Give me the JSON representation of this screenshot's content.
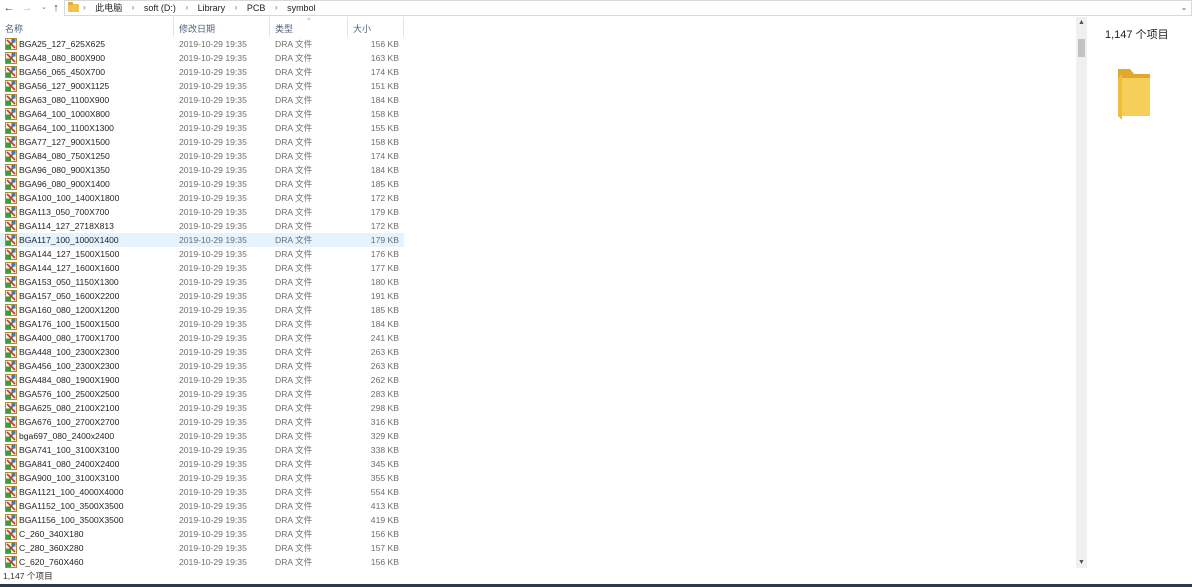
{
  "address": {
    "crumbs": [
      "此电脑",
      "soft (D:)",
      "Library",
      "PCB",
      "symbol"
    ]
  },
  "columns": {
    "name": "名称",
    "date": "修改日期",
    "type": "类型",
    "size": "大小"
  },
  "files": [
    {
      "name": "BGA25_127_625X625",
      "date": "2019-10-29 19:35",
      "type": "DRA 文件",
      "size": "156 KB"
    },
    {
      "name": "BGA48_080_800X900",
      "date": "2019-10-29 19:35",
      "type": "DRA 文件",
      "size": "163 KB"
    },
    {
      "name": "BGA56_065_450X700",
      "date": "2019-10-29 19:35",
      "type": "DRA 文件",
      "size": "174 KB"
    },
    {
      "name": "BGA56_127_900X1125",
      "date": "2019-10-29 19:35",
      "type": "DRA 文件",
      "size": "151 KB"
    },
    {
      "name": "BGA63_080_1100X900",
      "date": "2019-10-29 19:35",
      "type": "DRA 文件",
      "size": "184 KB"
    },
    {
      "name": "BGA64_100_1000X800",
      "date": "2019-10-29 19:35",
      "type": "DRA 文件",
      "size": "158 KB"
    },
    {
      "name": "BGA64_100_1100X1300",
      "date": "2019-10-29 19:35",
      "type": "DRA 文件",
      "size": "155 KB"
    },
    {
      "name": "BGA77_127_900X1500",
      "date": "2019-10-29 19:35",
      "type": "DRA 文件",
      "size": "158 KB"
    },
    {
      "name": "BGA84_080_750X1250",
      "date": "2019-10-29 19:35",
      "type": "DRA 文件",
      "size": "174 KB"
    },
    {
      "name": "BGA96_080_900X1350",
      "date": "2019-10-29 19:35",
      "type": "DRA 文件",
      "size": "184 KB"
    },
    {
      "name": "BGA96_080_900X1400",
      "date": "2019-10-29 19:35",
      "type": "DRA 文件",
      "size": "185 KB"
    },
    {
      "name": "BGA100_100_1400X1800",
      "date": "2019-10-29 19:35",
      "type": "DRA 文件",
      "size": "172 KB"
    },
    {
      "name": "BGA113_050_700X700",
      "date": "2019-10-29 19:35",
      "type": "DRA 文件",
      "size": "179 KB"
    },
    {
      "name": "BGA114_127_2718X813",
      "date": "2019-10-29 19:35",
      "type": "DRA 文件",
      "size": "172 KB"
    },
    {
      "name": "BGA117_100_1000X1400",
      "date": "2019-10-29 19:35",
      "type": "DRA 文件",
      "size": "179 KB",
      "selected": true
    },
    {
      "name": "BGA144_127_1500X1500",
      "date": "2019-10-29 19:35",
      "type": "DRA 文件",
      "size": "176 KB"
    },
    {
      "name": "BGA144_127_1600X1600",
      "date": "2019-10-29 19:35",
      "type": "DRA 文件",
      "size": "177 KB"
    },
    {
      "name": "BGA153_050_1150X1300",
      "date": "2019-10-29 19:35",
      "type": "DRA 文件",
      "size": "180 KB"
    },
    {
      "name": "BGA157_050_1600X2200",
      "date": "2019-10-29 19:35",
      "type": "DRA 文件",
      "size": "191 KB"
    },
    {
      "name": "BGA160_080_1200X1200",
      "date": "2019-10-29 19:35",
      "type": "DRA 文件",
      "size": "185 KB"
    },
    {
      "name": "BGA176_100_1500X1500",
      "date": "2019-10-29 19:35",
      "type": "DRA 文件",
      "size": "184 KB"
    },
    {
      "name": "BGA400_080_1700X1700",
      "date": "2019-10-29 19:35",
      "type": "DRA 文件",
      "size": "241 KB"
    },
    {
      "name": "BGA448_100_2300X2300",
      "date": "2019-10-29 19:35",
      "type": "DRA 文件",
      "size": "263 KB"
    },
    {
      "name": "BGA456_100_2300X2300",
      "date": "2019-10-29 19:35",
      "type": "DRA 文件",
      "size": "263 KB"
    },
    {
      "name": "BGA484_080_1900X1900",
      "date": "2019-10-29 19:35",
      "type": "DRA 文件",
      "size": "262 KB"
    },
    {
      "name": "BGA576_100_2500X2500",
      "date": "2019-10-29 19:35",
      "type": "DRA 文件",
      "size": "283 KB"
    },
    {
      "name": "BGA625_080_2100X2100",
      "date": "2019-10-29 19:35",
      "type": "DRA 文件",
      "size": "298 KB"
    },
    {
      "name": "BGA676_100_2700X2700",
      "date": "2019-10-29 19:35",
      "type": "DRA 文件",
      "size": "316 KB"
    },
    {
      "name": "bga697_080_2400x2400",
      "date": "2019-10-29 19:35",
      "type": "DRA 文件",
      "size": "329 KB"
    },
    {
      "name": "BGA741_100_3100X3100",
      "date": "2019-10-29 19:35",
      "type": "DRA 文件",
      "size": "338 KB"
    },
    {
      "name": "BGA841_080_2400X2400",
      "date": "2019-10-29 19:35",
      "type": "DRA 文件",
      "size": "345 KB"
    },
    {
      "name": "BGA900_100_3100X3100",
      "date": "2019-10-29 19:35",
      "type": "DRA 文件",
      "size": "355 KB"
    },
    {
      "name": "BGA1121_100_4000X4000",
      "date": "2019-10-29 19:35",
      "type": "DRA 文件",
      "size": "554 KB"
    },
    {
      "name": "BGA1152_100_3500X3500",
      "date": "2019-10-29 19:35",
      "type": "DRA 文件",
      "size": "413 KB"
    },
    {
      "name": "BGA1156_100_3500X3500",
      "date": "2019-10-29 19:35",
      "type": "DRA 文件",
      "size": "419 KB"
    },
    {
      "name": "C_260_340X180",
      "date": "2019-10-29 19:35",
      "type": "DRA 文件",
      "size": "156 KB"
    },
    {
      "name": "C_280_360X280",
      "date": "2019-10-29 19:35",
      "type": "DRA 文件",
      "size": "157 KB"
    },
    {
      "name": "C_620_760X460",
      "date": "2019-10-29 19:35",
      "type": "DRA 文件",
      "size": "156 KB"
    }
  ],
  "preview": {
    "count": "1,147 个项目"
  },
  "status": {
    "text": "1,147 个项目"
  },
  "icons": {
    "back": "arrow-left-icon",
    "forward": "arrow-right-icon",
    "recent": "chevron-down-icon",
    "up": "arrow-up-icon",
    "file": "dra-file-icon",
    "folder": "folder-icon"
  },
  "colors": {
    "selection": "#e5f3ff",
    "header_text": "#4c607a",
    "folder": "#f1c24d"
  }
}
